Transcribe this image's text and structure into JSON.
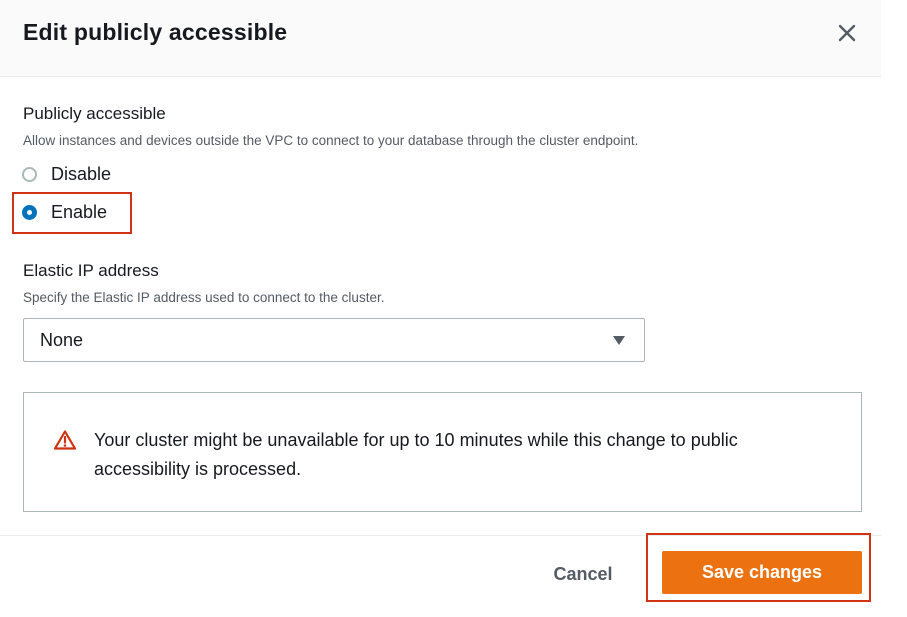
{
  "modal": {
    "title": "Edit publicly accessible",
    "close_icon": "close-icon"
  },
  "publicly_accessible": {
    "label": "Publicly accessible",
    "description": "Allow instances and devices outside the VPC to connect to your database through the cluster endpoint.",
    "options": [
      {
        "label": "Disable",
        "selected": false
      },
      {
        "label": "Enable",
        "selected": true
      }
    ]
  },
  "elastic_ip": {
    "label": "Elastic IP address",
    "description": "Specify the Elastic IP address used to connect to the cluster.",
    "selected_value": "None"
  },
  "alert": {
    "icon": "warning-icon",
    "message": "Your cluster might be unavailable for up to 10 minutes while this change to public accessibility is processed."
  },
  "footer": {
    "cancel_label": "Cancel",
    "save_label": "Save changes"
  },
  "colors": {
    "primary_button": "#ec7211",
    "radio_selected": "#0073bb",
    "highlight_border": "#d13212",
    "warning": "#d13212"
  }
}
